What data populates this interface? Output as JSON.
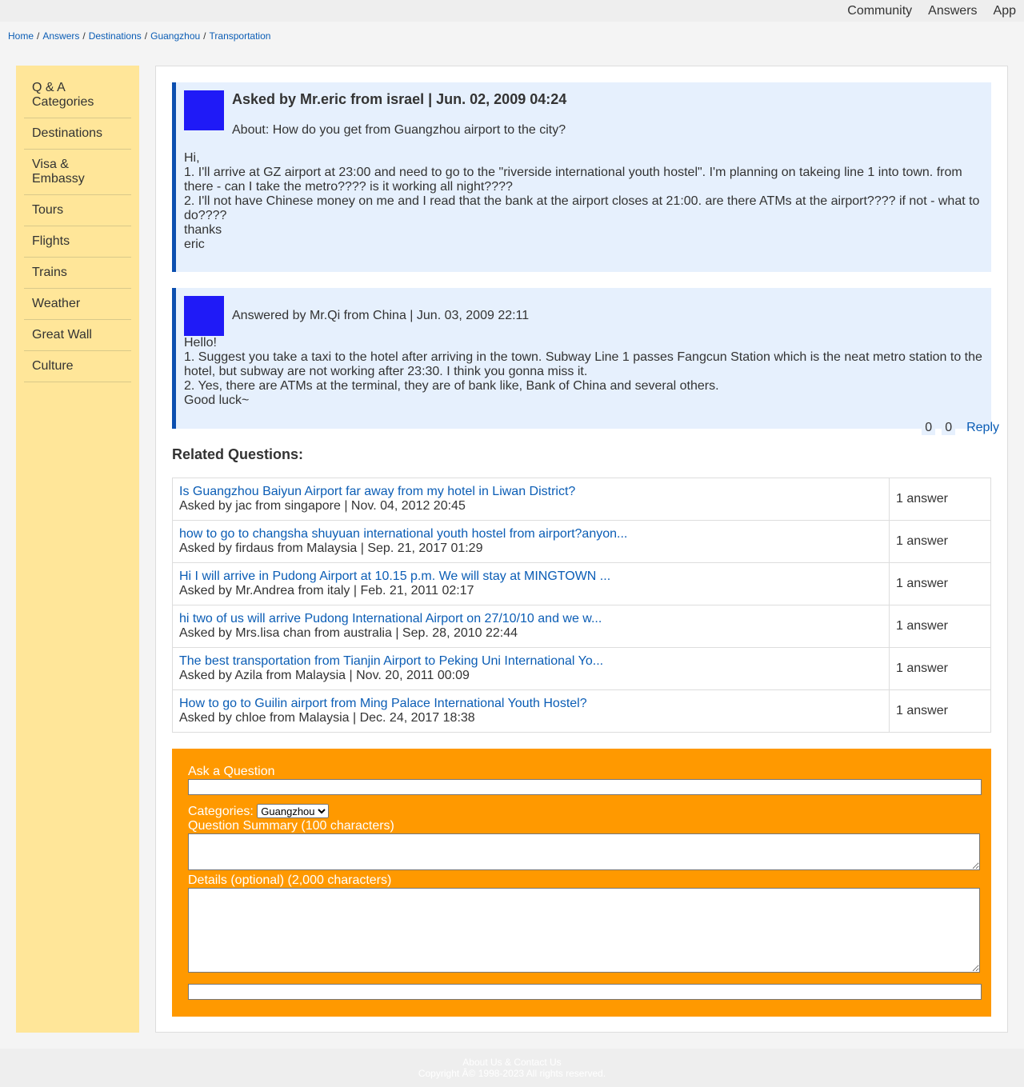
{
  "topnav": {
    "items": [
      "Community",
      "Answers",
      "App"
    ]
  },
  "breadcrumb": [
    "Home",
    "Answers",
    "Destinations",
    "Guangzhou",
    "Transportation"
  ],
  "sidebar": {
    "items": [
      "Q & A Categories",
      "Destinations",
      "Visa & Embassy",
      "Tours",
      "Flights",
      "Trains",
      "Weather",
      "Great Wall",
      "Culture"
    ]
  },
  "question": {
    "title": "Asked by Mr.eric from israel | Jun. 02, 2009 04:24",
    "about": "About: How do you get from Guangzhou airport to the city?",
    "body": [
      "Hi,",
      "1. I'll arrive at GZ airport at 23:00 and need to go to the \"riverside international youth hostel\". I'm planning on takeing line 1 into town. from there - can I take the metro???? is it working all night????",
      "2. I'll not have Chinese money on me and I read that the bank at the airport closes at 21:00. are there ATMs at the airport???? if not - what to do????",
      "thanks",
      "eric"
    ]
  },
  "answer": {
    "title": "Answered by Mr.Qi from China | Jun. 03, 2009 22:11",
    "body": [
      "Hello!",
      "1. Suggest you take a taxi to the hotel after arriving in the town. Subway Line 1 passes Fangcun Station which is the neat metro station to the hotel, but subway are not working after 23:30. I think you gonna miss it.",
      "2. Yes, there are ATMs at the terminal, they are of bank like, Bank of China and several others.",
      "Good luck~"
    ],
    "votes_up": "0",
    "votes_down": "0",
    "reply_label": "Reply"
  },
  "related": {
    "title": "Related Questions:",
    "items": [
      {
        "question": "Is Guangzhou Baiyun Airport far away from my hotel in Liwan District?",
        "meta": "Asked by jac from singapore | Nov. 04, 2012 20:45",
        "answers": "1 answer"
      },
      {
        "question": "how to go to changsha shuyuan international youth hostel from airport?anyon...",
        "meta": "Asked by firdaus from Malaysia | Sep. 21, 2017 01:29",
        "answers": "1 answer"
      },
      {
        "question": "Hi I will arrive in Pudong Airport at 10.15 p.m. We will stay at MINGTOWN ...",
        "meta": "Asked by Mr.Andrea from italy | Feb. 21, 2011 02:17",
        "answers": "1 answer"
      },
      {
        "question": "hi two of us will arrive Pudong International Airport on 27/10/10 and we w...",
        "meta": "Asked by Mrs.lisa chan from australia | Sep. 28, 2010 22:44",
        "answers": "1 answer"
      },
      {
        "question": "The best transportation from Tianjin Airport to Peking Uni International Yo...",
        "meta": "Asked by Azila from Malaysia | Nov. 20, 2011 00:09",
        "answers": "1 answer"
      },
      {
        "question": "How to go to Guilin airport from Ming Palace International Youth Hostel?",
        "meta": "Asked by chloe from Malaysia | Dec. 24, 2017 18:38",
        "answers": "1 answer"
      }
    ]
  },
  "ask": {
    "title": "Ask a Question",
    "categories_label": "Categories:",
    "category_selected": "Guangzhou",
    "summary_label": "Question Summary (100 characters)",
    "details_label": "Details (optional) (2,000 characters)"
  },
  "footer": {
    "links": "About Us & Contact Us",
    "copyright": "Copyright Â© 1998-2023 All rights reserved."
  },
  "colors": {
    "accent_link": "#0b5db5",
    "sidebar_bg": "#ffe699",
    "post_bg": "#e6f0fd",
    "post_border": "#0b4fb0",
    "avatar": "#1f1af7",
    "ask_bg": "#ff9900"
  }
}
